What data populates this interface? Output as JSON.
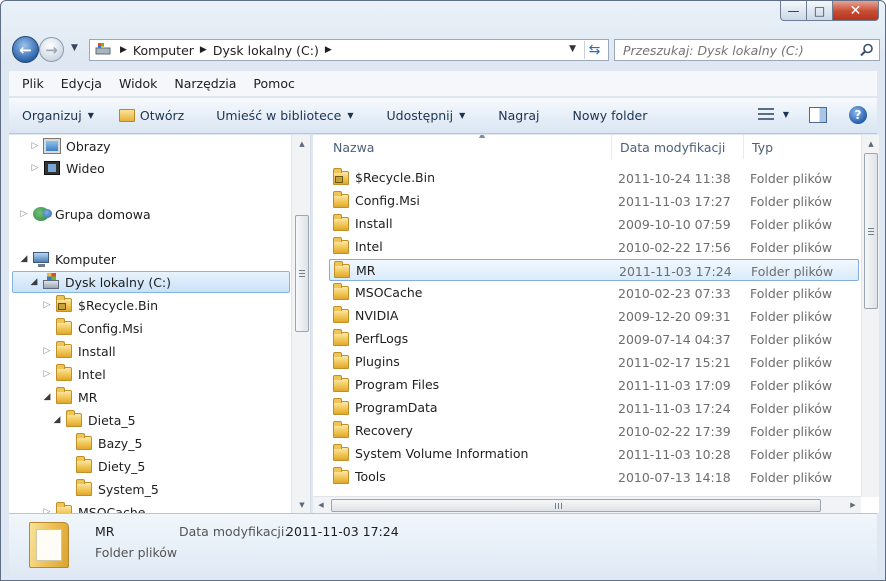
{
  "window": {
    "title_buttons": {
      "minimize": "—",
      "maximize": "□",
      "close": "✕"
    }
  },
  "nav": {
    "back_glyph": "←",
    "forward_glyph": "→",
    "breadcrumb": [
      "Komputer",
      "Dysk lokalny (C:)"
    ],
    "search_placeholder": "Przeszukaj: Dysk lokalny (C:)"
  },
  "menu": [
    "Plik",
    "Edycja",
    "Widok",
    "Narzędzia",
    "Pomoc"
  ],
  "toolbar": {
    "organize": "Organizuj",
    "open": "Otwórz",
    "include_library": "Umieść w bibliotece",
    "share": "Udostępnij",
    "burn": "Nagraj",
    "new_folder": "Nowy folder",
    "help": "?"
  },
  "tree": [
    {
      "label": "Obrazy",
      "icon": "pictures-icon"
    },
    {
      "label": "Wideo",
      "icon": "video-icon"
    },
    {
      "label": "Grupa domowa",
      "icon": "homegroup-icon"
    },
    {
      "label": "Komputer",
      "icon": "computer-icon"
    },
    {
      "label": "Dysk lokalny (C:)",
      "icon": "drive-icon"
    },
    {
      "label": "$Recycle.Bin",
      "icon": "locked-folder-icon"
    },
    {
      "label": "Config.Msi",
      "icon": "folder-icon"
    },
    {
      "label": "Install",
      "icon": "folder-icon"
    },
    {
      "label": "Intel",
      "icon": "folder-icon"
    },
    {
      "label": "MR",
      "icon": "folder-icon"
    },
    {
      "label": "Dieta_5",
      "icon": "folder-icon"
    },
    {
      "label": "Bazy_5",
      "icon": "folder-icon"
    },
    {
      "label": "Diety_5",
      "icon": "folder-icon"
    },
    {
      "label": "System_5",
      "icon": "folder-icon"
    },
    {
      "label": "MSOCache",
      "icon": "folder-icon"
    }
  ],
  "columns": {
    "name": "Nazwa",
    "date": "Data modyfikacji",
    "type": "Typ"
  },
  "files": [
    {
      "name": "$Recycle.Bin",
      "date": "2011-10-24 11:38",
      "type": "Folder plików",
      "locked": true
    },
    {
      "name": "Config.Msi",
      "date": "2011-11-03 17:27",
      "type": "Folder plików"
    },
    {
      "name": "Install",
      "date": "2009-10-10 07:59",
      "type": "Folder plików"
    },
    {
      "name": "Intel",
      "date": "2010-02-22 17:56",
      "type": "Folder plików"
    },
    {
      "name": "MR",
      "date": "2011-11-03 17:24",
      "type": "Folder plików",
      "selected": true
    },
    {
      "name": "MSOCache",
      "date": "2010-02-23 07:33",
      "type": "Folder plików"
    },
    {
      "name": "NVIDIA",
      "date": "2009-12-20 09:31",
      "type": "Folder plików"
    },
    {
      "name": "PerfLogs",
      "date": "2009-07-14 04:37",
      "type": "Folder plików"
    },
    {
      "name": "Plugins",
      "date": "2011-02-17 15:21",
      "type": "Folder plików"
    },
    {
      "name": "Program Files",
      "date": "2011-11-03 17:09",
      "type": "Folder plików"
    },
    {
      "name": "ProgramData",
      "date": "2011-11-03 17:24",
      "type": "Folder plików"
    },
    {
      "name": "Recovery",
      "date": "2010-02-22 17:39",
      "type": "Folder plików"
    },
    {
      "name": "System Volume Information",
      "date": "2011-11-03 10:28",
      "type": "Folder plików"
    },
    {
      "name": "Tools",
      "date": "2010-07-13 14:18",
      "type": "Folder plików"
    }
  ],
  "details": {
    "name": "MR",
    "type": "Folder plików",
    "date_label": "Data modyfikacji:",
    "date_value": "2011-11-03 17:24"
  }
}
